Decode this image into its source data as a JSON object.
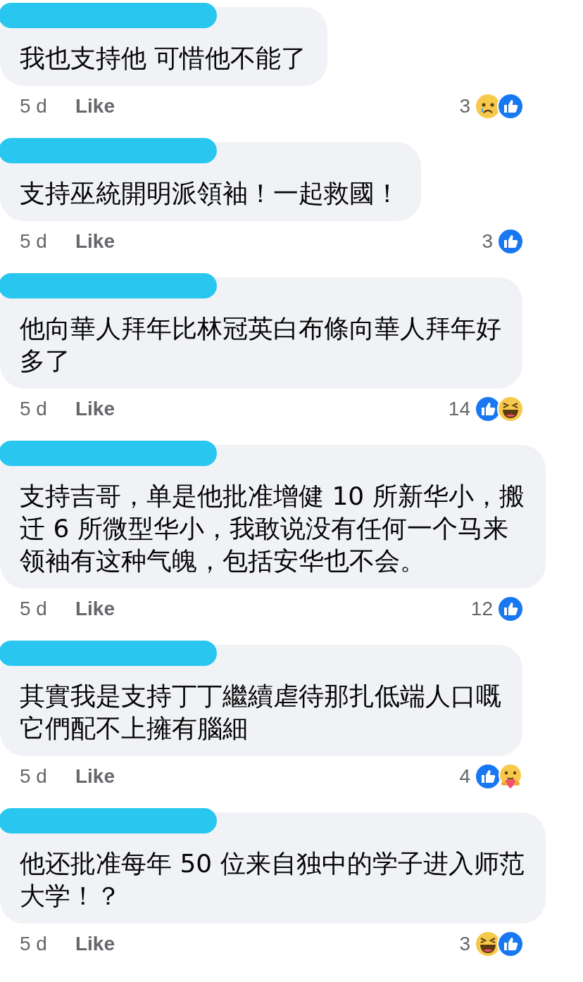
{
  "comments": [
    {
      "name_redacted": true,
      "lines": [
        "我也支持他 可惜他不能了"
      ],
      "time": "5 d",
      "like_label": "Like",
      "reaction_count": "3",
      "reactions": [
        {
          "kind": "sad"
        },
        {
          "kind": "like"
        }
      ]
    },
    {
      "name_redacted": true,
      "lines": [
        "支持巫統開明派領袖！一起救國！"
      ],
      "time": "5 d",
      "like_label": "Like",
      "reaction_count": "3",
      "reactions": [
        {
          "kind": "like"
        }
      ]
    },
    {
      "name_redacted": true,
      "lines": [
        "他向華人拜年比林冠英白布條向華人拜年好",
        "多了"
      ],
      "time": "5 d",
      "like_label": "Like",
      "reaction_count": "14",
      "reactions": [
        {
          "kind": "like"
        },
        {
          "kind": "haha"
        }
      ]
    },
    {
      "name_redacted": true,
      "lines": [
        "支持吉哥，单是他批准增健 10 所新华小，搬",
        "迁 6 所微型华小，我敢说没有任何一个马来",
        "领袖有这种气魄，包括安华也不会。"
      ],
      "time": "5 d",
      "like_label": "Like",
      "reaction_count": "12",
      "reactions": [
        {
          "kind": "like"
        }
      ]
    },
    {
      "name_redacted": true,
      "lines": [
        "其實我是支持丁丁繼續虐待那扎低端人口嘅",
        "它們配不上擁有腦細"
      ],
      "time": "5 d",
      "like_label": "Like",
      "reaction_count": "4",
      "reactions": [
        {
          "kind": "like"
        },
        {
          "kind": "care"
        }
      ]
    },
    {
      "name_redacted": true,
      "lines": [
        "他还批准每年 50 位来自独中的学子进入师范",
        "大学！？"
      ],
      "time": "5 d",
      "like_label": "Like",
      "reaction_count": "3",
      "reactions": [
        {
          "kind": "haha"
        },
        {
          "kind": "like"
        }
      ]
    }
  ]
}
